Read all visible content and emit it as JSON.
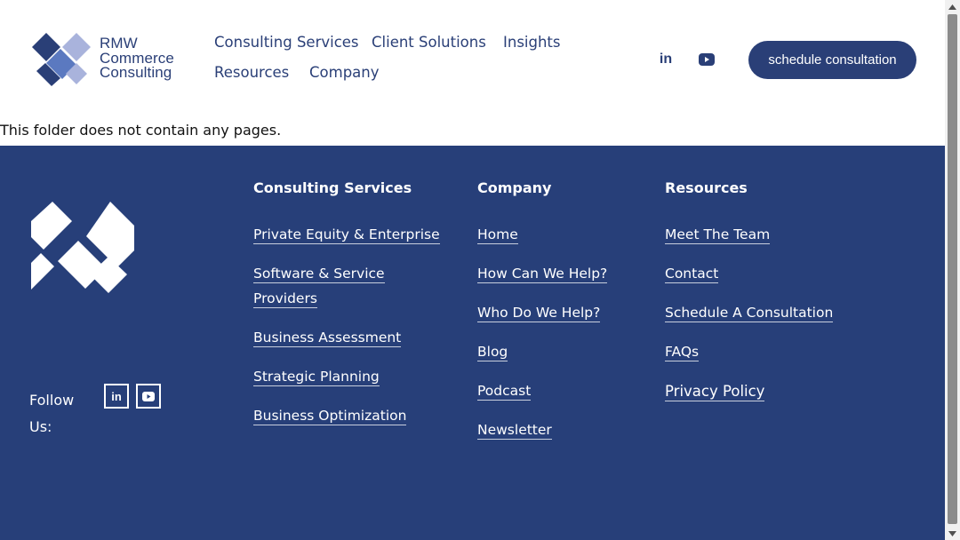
{
  "colors": {
    "brand": "#2a3f77",
    "footer_bg": "#273f79",
    "light_accent": "#a9b3dc",
    "mid_accent": "#5b79c0"
  },
  "header": {
    "logo": {
      "line1": "RMW",
      "line2": "Commerce",
      "line3": "Consulting",
      "icon": "rmw-diamond-logo-icon"
    },
    "nav": [
      "Consulting Services",
      "Client Solutions",
      "Insights",
      "Resources",
      "Company"
    ],
    "social": [
      {
        "icon": "linkedin-icon",
        "glyph": "in"
      },
      {
        "icon": "youtube-icon"
      }
    ],
    "cta": "schedule consultation"
  },
  "main": {
    "empty_message": "This folder does not contain any pages."
  },
  "footer": {
    "follow_label": "Follow Us:",
    "social": [
      {
        "icon": "linkedin-icon",
        "glyph": "in"
      },
      {
        "icon": "youtube-icon"
      }
    ],
    "columns": [
      {
        "title": "Consulting Services",
        "links": [
          "Private Equity & Enterprise",
          "Software & Service",
          "Providers",
          "Business Assessment",
          "Strategic Planning",
          "Business Optimization"
        ]
      },
      {
        "title": "Company",
        "links": [
          "Home",
          "How Can We Help?",
          "Who Do We Help?",
          "Blog",
          "Podcast",
          "Newsletter"
        ]
      },
      {
        "title": "Resources",
        "links": [
          "Meet The Team",
          "Contact",
          "Schedule A Consultation",
          "FAQs",
          "Privacy Policy"
        ]
      }
    ]
  },
  "scrollbar": {
    "up_icon": "scroll-up-arrow-icon",
    "down_icon": "scroll-down-arrow-icon"
  }
}
